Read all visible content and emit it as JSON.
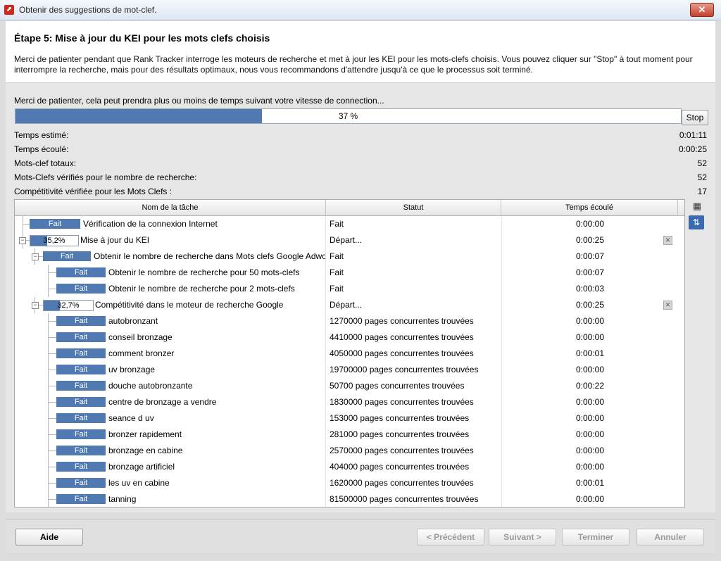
{
  "window": {
    "title": "Obtenir des suggestions de mot-clef."
  },
  "header": {
    "title": "Étape 5:  Mise à jour du KEI pour les mots clefs choisis",
    "description": "Merci de patienter pendant que Rank Tracker interroge les moteurs de recherche et met à jour les KEI pour les mots-clefs choisis. Vous pouvez cliquer sur \"Stop\" à tout moment pour interrompre la recherche, mais pour des résultats optimaux, nous vous recommandons d'attendre jusqu'à ce que le processus soit terminé."
  },
  "progress": {
    "message": "Merci de patienter, cela peut prendra plus ou moins de temps suivant votre vitesse de connection...",
    "percent": 37,
    "label": "37 %",
    "stop_label": "Stop"
  },
  "stats": [
    {
      "label": "Temps estimé:",
      "value": "0:01:11"
    },
    {
      "label": "Temps écoulé:",
      "value": "0:00:25"
    },
    {
      "label": "Mots-clef totaux:",
      "value": "52"
    },
    {
      "label": "Mots-Clefs vérifiés pour le nombre de recherche:",
      "value": "52"
    },
    {
      "label": "Compétitivité vérifiée pour les Mots Clefs :",
      "value": "17"
    }
  ],
  "table": {
    "columns": [
      "Nom de la tâche",
      "Statut",
      "Temps écoulé"
    ],
    "rows": [
      {
        "level": 0,
        "bar": "Fait",
        "progress": 100,
        "task": "Vérification de la connexion Internet",
        "status": "Fait",
        "time": "0:00:00"
      },
      {
        "level": 0,
        "bar": "35,2%",
        "progress": 35.2,
        "task": "Mise à jour du KEI",
        "status": "Départ...",
        "time": "0:00:25",
        "expand": true,
        "cancel": true
      },
      {
        "level": 1,
        "bar": "Fait",
        "progress": 100,
        "task": "Obtenir le nombre de recherche dans Mots clefs Google Adwords",
        "status": "Fait",
        "time": "0:00:07",
        "expand": true
      },
      {
        "level": 2,
        "bar": "Fait",
        "progress": 100,
        "task": "Obtenir le nombre de recherche pour 50 mots-clefs",
        "status": "Fait",
        "time": "0:00:07"
      },
      {
        "level": 2,
        "bar": "Fait",
        "progress": 100,
        "task": "Obtenir le nombre de recherche pour 2 mots-clefs",
        "status": "Fait",
        "time": "0:00:03"
      },
      {
        "level": 1,
        "bar": "32,7%",
        "progress": 32.7,
        "task": "Compétitivité dans le moteur de recherche Google",
        "status": "Départ...",
        "time": "0:00:25",
        "expand": true,
        "cancel": true
      },
      {
        "level": 2,
        "bar": "Fait",
        "progress": 100,
        "task": "autobronzant",
        "status": "1270000 pages concurrentes trouvées",
        "time": "0:00:00"
      },
      {
        "level": 2,
        "bar": "Fait",
        "progress": 100,
        "task": "conseil bronzage",
        "status": "4410000 pages concurrentes trouvées",
        "time": "0:00:00"
      },
      {
        "level": 2,
        "bar": "Fait",
        "progress": 100,
        "task": "comment bronzer",
        "status": "4050000 pages concurrentes trouvées",
        "time": "0:00:01"
      },
      {
        "level": 2,
        "bar": "Fait",
        "progress": 100,
        "task": "uv bronzage",
        "status": "19700000 pages concurrentes trouvées",
        "time": "0:00:00"
      },
      {
        "level": 2,
        "bar": "Fait",
        "progress": 100,
        "task": "douche autobronzante",
        "status": "50700 pages concurrentes trouvées",
        "time": "0:00:22"
      },
      {
        "level": 2,
        "bar": "Fait",
        "progress": 100,
        "task": "centre de bronzage a vendre",
        "status": "1830000 pages concurrentes trouvées",
        "time": "0:00:00"
      },
      {
        "level": 2,
        "bar": "Fait",
        "progress": 100,
        "task": "seance d uv",
        "status": "153000 pages concurrentes trouvées",
        "time": "0:00:00"
      },
      {
        "level": 2,
        "bar": "Fait",
        "progress": 100,
        "task": "bronzer rapidement",
        "status": "281000 pages concurrentes trouvées",
        "time": "0:00:00"
      },
      {
        "level": 2,
        "bar": "Fait",
        "progress": 100,
        "task": "bronzage en cabine",
        "status": "2570000 pages concurrentes trouvées",
        "time": "0:00:00"
      },
      {
        "level": 2,
        "bar": "Fait",
        "progress": 100,
        "task": "bronzage artificiel",
        "status": "404000 pages concurrentes trouvées",
        "time": "0:00:00"
      },
      {
        "level": 2,
        "bar": "Fait",
        "progress": 100,
        "task": "les uv en cabine",
        "status": "1620000 pages concurrentes trouvées",
        "time": "0:00:01"
      },
      {
        "level": 2,
        "bar": "Fait",
        "progress": 100,
        "task": "tanning",
        "status": "81500000 pages concurrentes trouvées",
        "time": "0:00:00"
      }
    ]
  },
  "footer": {
    "help": "Aide",
    "previous": "< Précédent",
    "next": "Suivant >",
    "finish": "Terminer",
    "cancel": "Annuler"
  },
  "colors": {
    "accent": "#4f79b0",
    "close": "#c4412c"
  },
  "icons": {
    "app": "rank-tracker-icon",
    "close": "close-icon",
    "table": "table-view-icon",
    "columns": "column-settings-icon"
  }
}
